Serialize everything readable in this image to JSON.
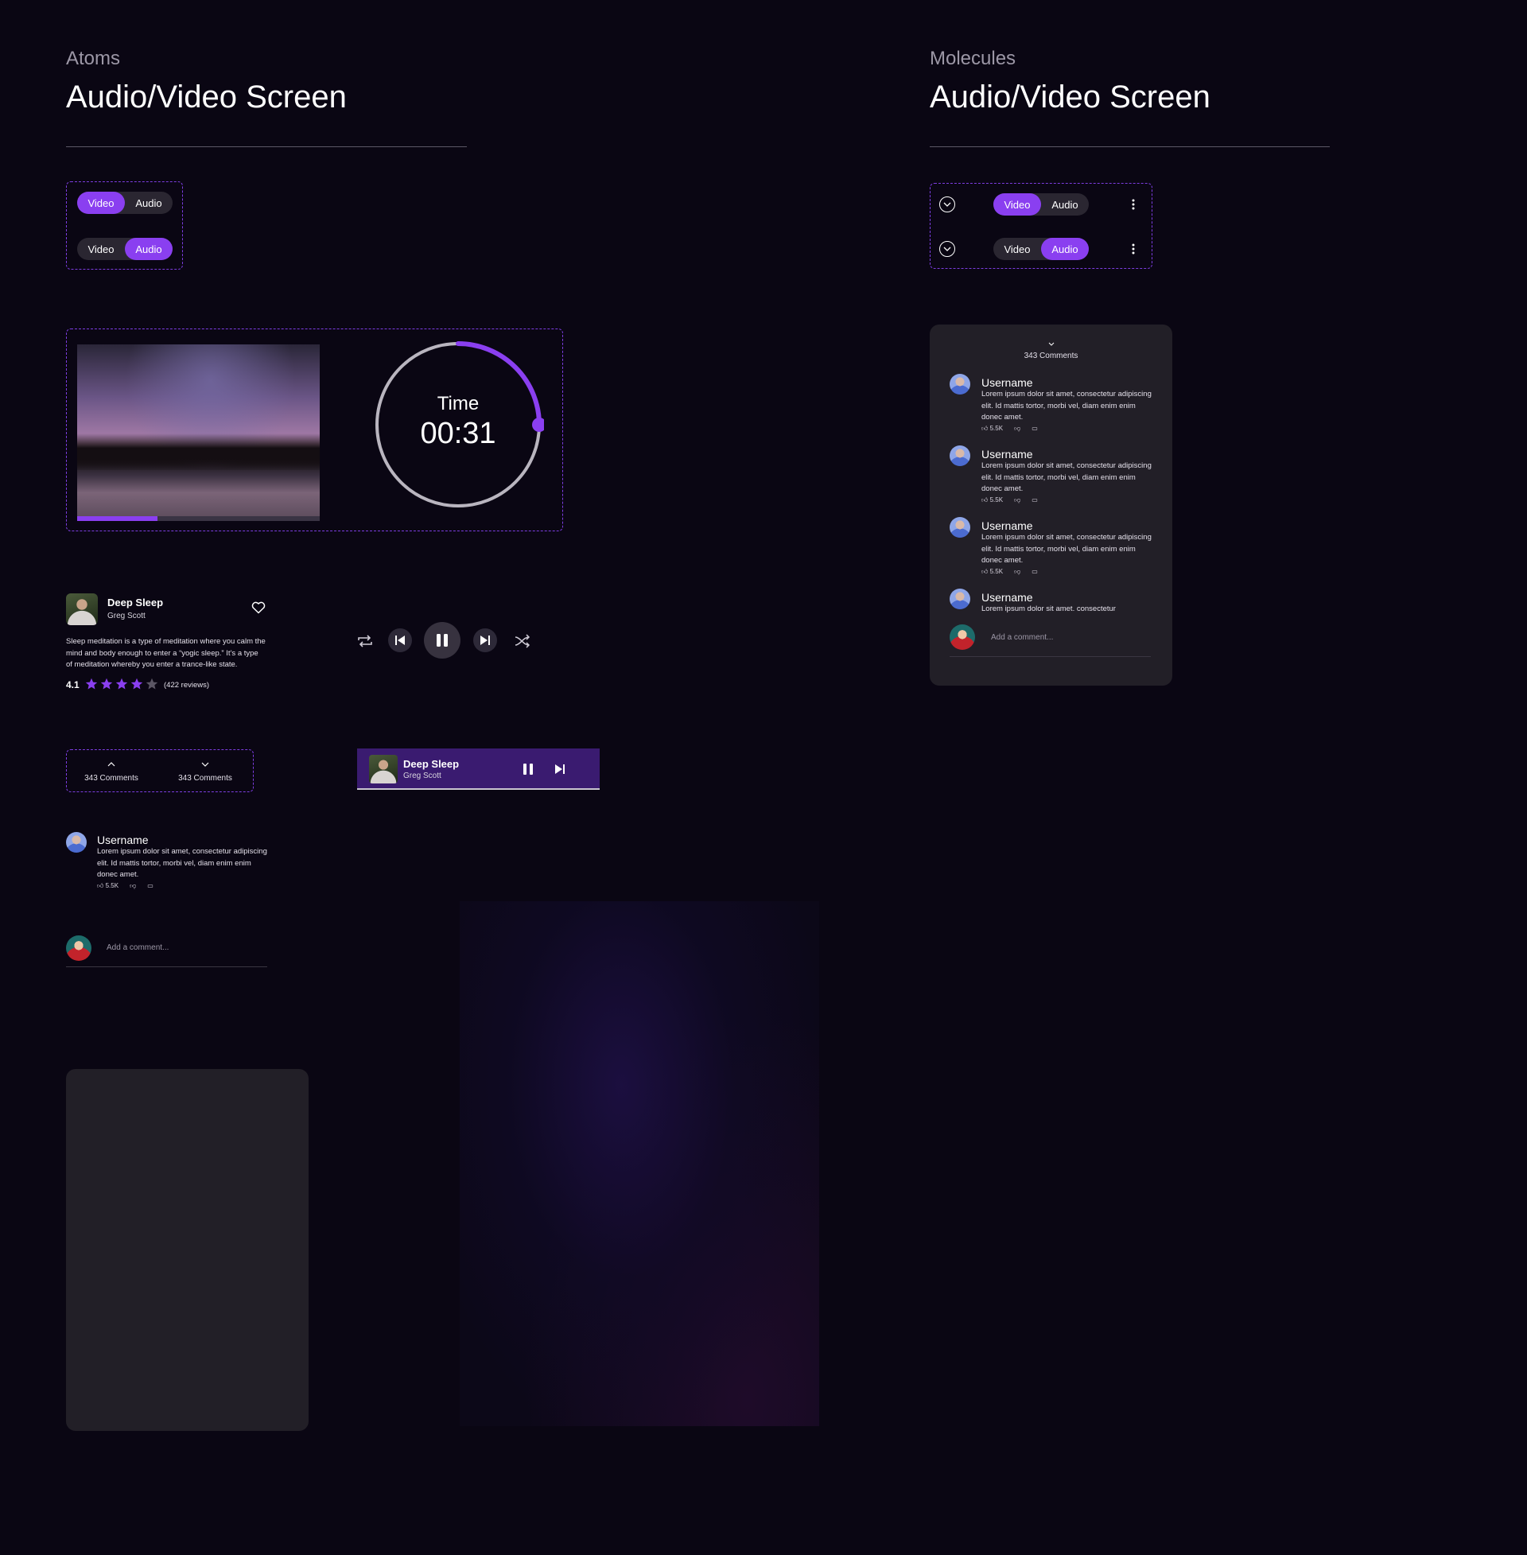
{
  "atoms": {
    "kicker": "Atoms",
    "title": "Audio/Video Screen",
    "toggle_video": "Video",
    "toggle_audio": "Audio",
    "timer_label": "Time",
    "timer_value": "00:31",
    "timer_progress": 0.25,
    "video_progress": 0.33,
    "track": {
      "title": "Deep Sleep",
      "artist": "Greg Scott",
      "description": "Sleep meditation is a type of meditation where you calm the mind and body enough to enter a “yogic sleep.” It’s a type of meditation whereby you enter a trance-like state.",
      "rating": "4.1",
      "stars_filled": 4,
      "stars_total": 5,
      "reviews": "(422 reviews)"
    },
    "comments_toggle_up": "343 Comments",
    "comments_toggle_down": "343 Comments",
    "mini_player": {
      "title": "Deep Sleep",
      "artist": "Greg Scott"
    },
    "comment": {
      "username": "Username",
      "body": "Lorem ipsum dolor sit amet, consectetur adipiscing elit. Id mattis tortor, morbi vel, diam enim enim donec amet.",
      "likes": "5.5K"
    },
    "add_comment_placeholder": "Add a comment..."
  },
  "molecules": {
    "kicker": "Molecules",
    "title": "Audio/Video Screen",
    "toggle_video": "Video",
    "toggle_audio": "Audio",
    "comments_count": "343 Comments",
    "comments": [
      {
        "username": "Username",
        "body": "Lorem ipsum dolor sit amet, consectetur adipiscing elit. Id mattis tortor, morbi vel, diam enim enim donec amet.",
        "likes": "5.5K"
      },
      {
        "username": "Username",
        "body": "Lorem ipsum dolor sit amet, consectetur adipiscing elit. Id mattis tortor, morbi vel, diam enim enim donec amet.",
        "likes": "5.5K"
      },
      {
        "username": "Username",
        "body": "Lorem ipsum dolor sit amet, consectetur adipiscing elit. Id mattis tortor, morbi vel, diam enim enim donec amet.",
        "likes": "5.5K"
      },
      {
        "username": "Username",
        "body": "Lorem ipsum dolor sit amet. consectetur"
      }
    ],
    "add_comment_placeholder": "Add a comment..."
  },
  "colors": {
    "background": "#0a0613",
    "accent": "#8a3ff0",
    "panel": "#221f27"
  }
}
